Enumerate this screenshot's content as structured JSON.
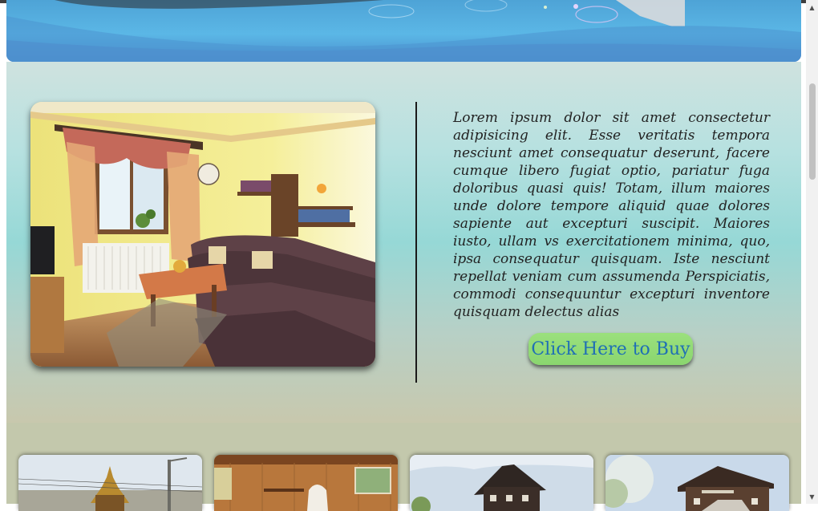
{
  "feature": {
    "description": "Lorem ipsum dolor sit amet consectetur adipisicing elit. Esse veritatis tempora nesciunt amet consequatur deserunt, facere cumque libero fugiat optio, pariatur fuga doloribus quasi quis! Totam, illum maiores unde dolore tempore aliquid quae dolores sapiente aut excepturi suscipit. Maiores iusto, ullam vs exercitationem minima, quo, ipsa consequatur quisquam. Iste nesciunt repellat veniam cum assumenda Perspiciatis, commodi consequuntur excepturi inventore quisquam delectus alias",
    "cta_label": "Click Here to Buy"
  },
  "colors": {
    "cta_background": "#8fd972",
    "cta_text": "#1f6fb5",
    "hero_blue": "#5bb7e6"
  },
  "icons": {
    "scroll_up": "▲",
    "scroll_down": "▼"
  }
}
